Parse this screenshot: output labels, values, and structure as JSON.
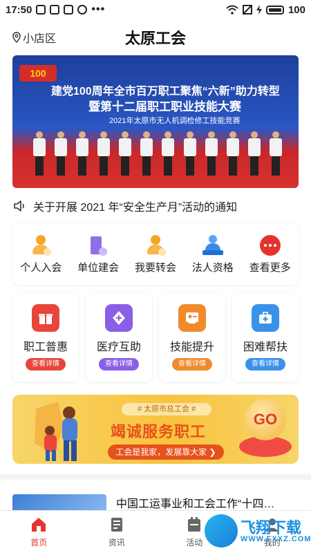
{
  "status_bar": {
    "time": "17:50",
    "battery": "100",
    "dots": "•••"
  },
  "header": {
    "location": "小店区",
    "title": "太原工会"
  },
  "banner": {
    "logo": "100",
    "line1": "建党100周年全市百万职工聚焦“六新”助力转型",
    "line2": "暨第十二届职工职业技能大赛",
    "line3": "2021年太原市无人机调检修工技能竞赛"
  },
  "notice": {
    "text": "关于开展 2021 年“安全生产月”活动的通知"
  },
  "quick_menu": [
    {
      "label": "个人入会",
      "icon": "person-join-icon"
    },
    {
      "label": "单位建会",
      "icon": "building-icon"
    },
    {
      "label": "我要转会",
      "icon": "person-transfer-icon"
    },
    {
      "label": "法人资格",
      "icon": "legal-person-icon"
    },
    {
      "label": "查看更多",
      "icon": "more-icon"
    }
  ],
  "services": [
    {
      "label": "职工普惠",
      "button": "查看详情",
      "icon": "gift-icon",
      "color": "#e8463c"
    },
    {
      "label": "医疗互助",
      "button": "查看详情",
      "icon": "medical-shield-icon",
      "color": "#8a5ee6"
    },
    {
      "label": "技能提升",
      "button": "查看详情",
      "icon": "certificate-icon",
      "color": "#f08a2b"
    },
    {
      "label": "困难帮扶",
      "button": "查看详情",
      "icon": "first-aid-icon",
      "color": "#3a91ea"
    }
  ],
  "promo": {
    "tag": "# 太原市总工会 #",
    "headline": "竭诚服务职工",
    "slogan": "工会是我家，发展靠大家 ❯",
    "go": "GO"
  },
  "news": {
    "headline": "中国工运事业和工会工作“十四…"
  },
  "tabbar": [
    {
      "label": "首页",
      "icon": "home-icon",
      "active": true
    },
    {
      "label": "资讯",
      "icon": "news-icon",
      "active": false
    },
    {
      "label": "活动",
      "icon": "activity-icon",
      "active": false
    },
    {
      "label": "我的",
      "icon": "profile-icon",
      "active": false
    }
  ],
  "watermark": {
    "text": "飞翔下载",
    "url": "WWW.FXXZ.COM"
  }
}
